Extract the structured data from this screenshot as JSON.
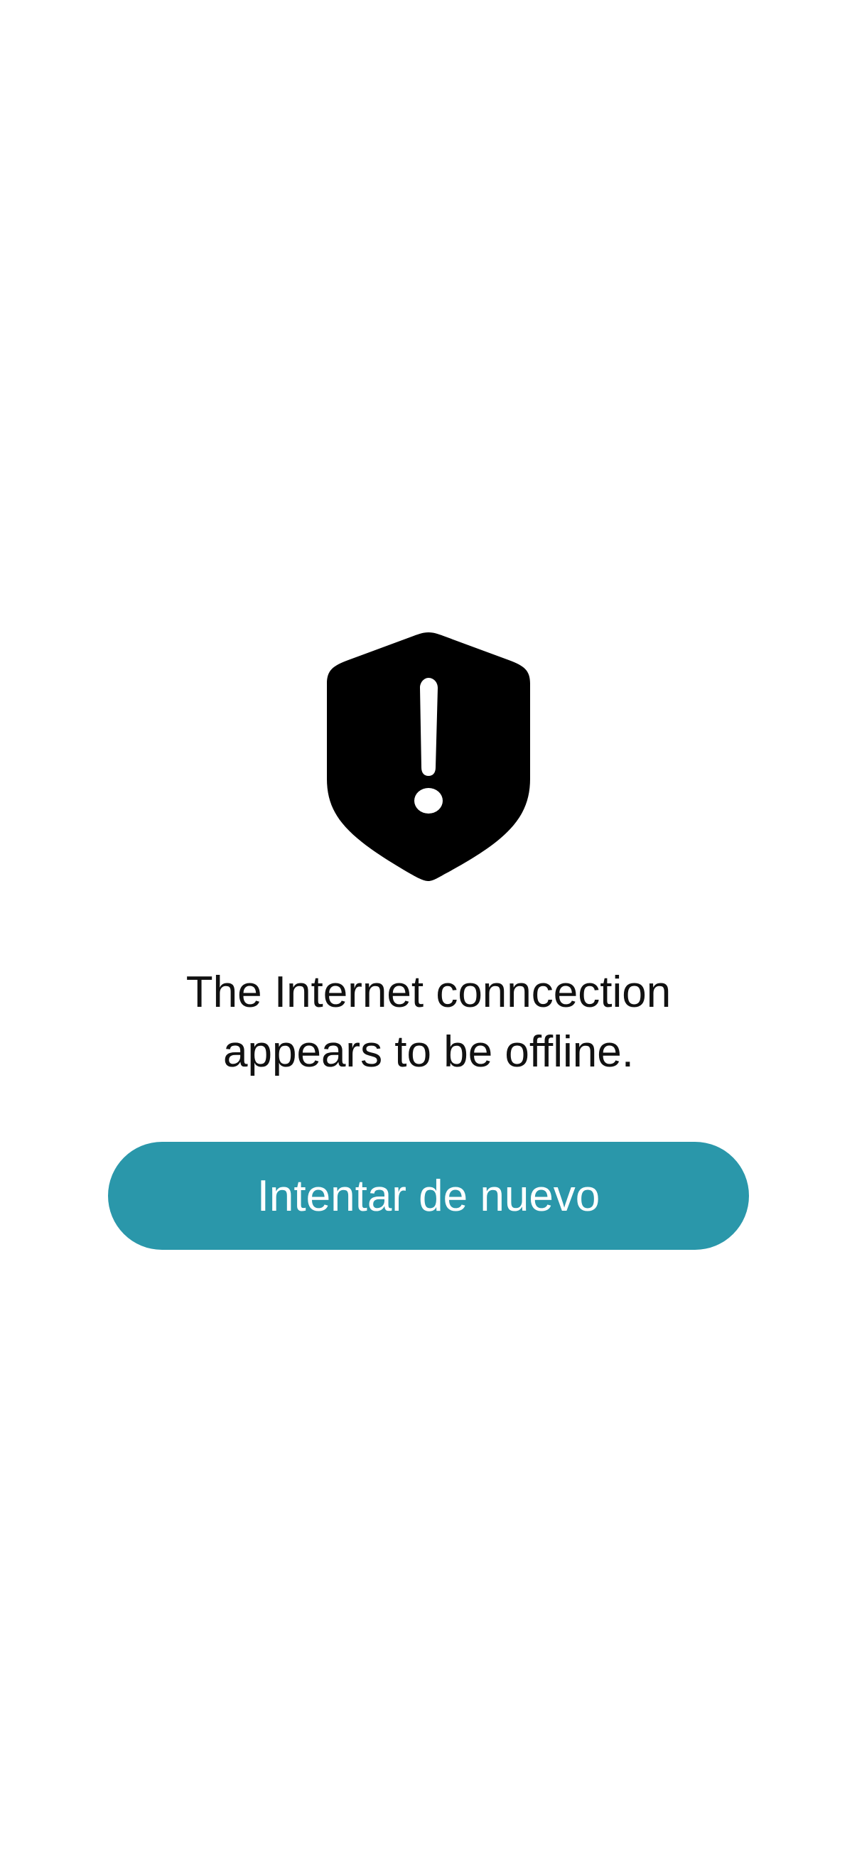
{
  "offline_screen": {
    "icon": "shield-exclamation-icon",
    "message": "The Internet conncection\nappears to be offline.",
    "retry_button_label": "Intentar de nuevo"
  },
  "colors": {
    "background": "#ffffff",
    "icon": "#000000",
    "text": "#111111",
    "button_background": "#2a97aa",
    "button_text": "#ffffff"
  }
}
